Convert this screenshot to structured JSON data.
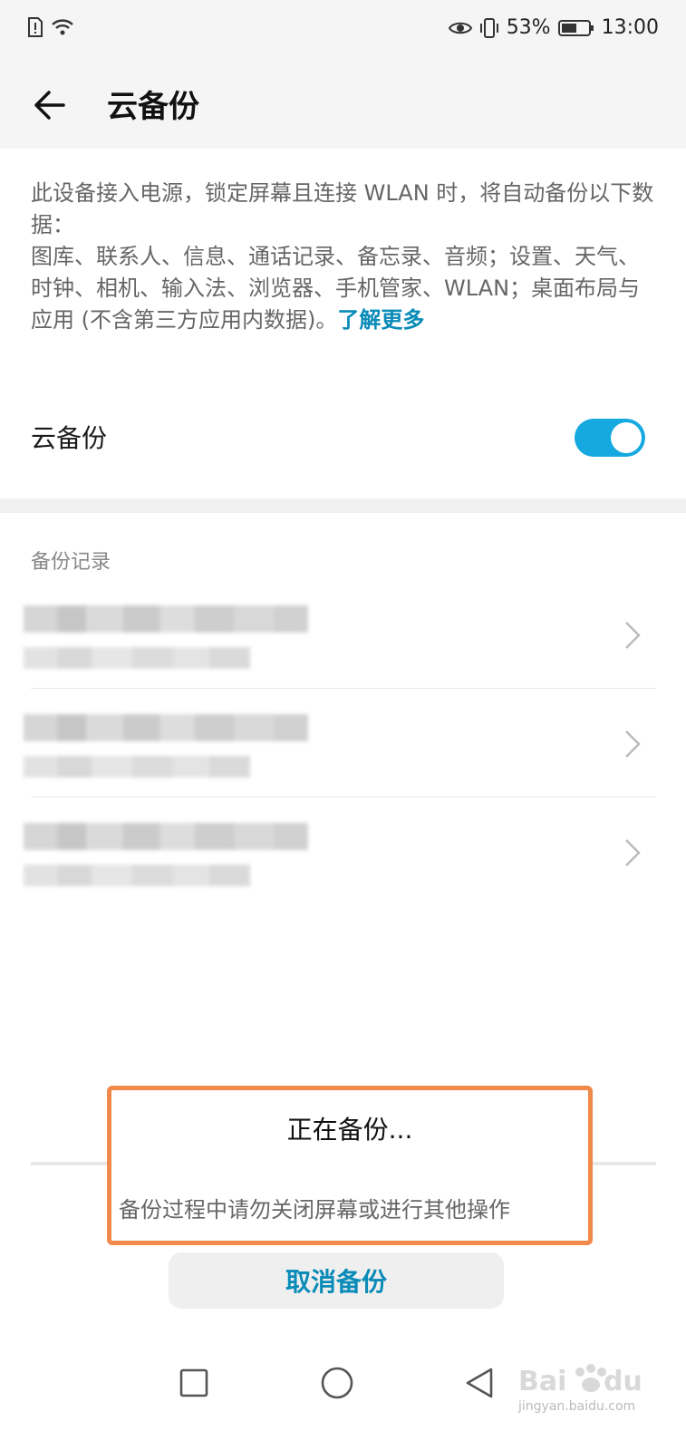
{
  "status_bar": {
    "battery": "53%",
    "time": "13:00"
  },
  "header": {
    "title": "云备份"
  },
  "description": {
    "text": "此设备接入电源，锁定屏幕且连接 WLAN 时，将自动备份以下数据：\n图库、联系人、信息、通话记录、备忘录、音频；设置、天气、时钟、相机、输入法、浏览器、手机管家、WLAN；桌面布局与应用 (不含第三方应用内数据)。",
    "link": "了解更多"
  },
  "cloud_backup_toggle": {
    "label": "云备份",
    "enabled": true
  },
  "backup_records": {
    "title": "备份记录",
    "items_count": 3
  },
  "dialog": {
    "title": "正在备份...",
    "message": "备份过程中请勿关闭屏幕或进行其他操作",
    "cancel_label": "取消备份"
  },
  "watermark": {
    "text": "jingyan.baidu.com"
  },
  "colors": {
    "accent": "#0a8bb8",
    "toggle_on": "#15a9df",
    "highlight_border": "#f0894a"
  }
}
